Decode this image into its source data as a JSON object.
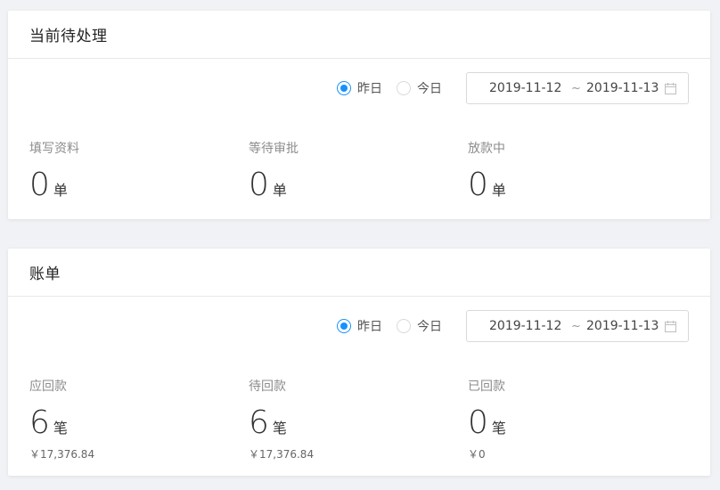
{
  "panel1": {
    "title": "当前待处理",
    "radios": [
      {
        "label": "昨日",
        "checked": true
      },
      {
        "label": "今日",
        "checked": false
      }
    ],
    "range": {
      "start": "2019-11-12",
      "separator": "~",
      "end": "2019-11-13"
    },
    "stats": [
      {
        "label": "填写资料",
        "value": "0",
        "unit": "单"
      },
      {
        "label": "等待审批",
        "value": "0",
        "unit": "单"
      },
      {
        "label": "放款中",
        "value": "0",
        "unit": "单"
      }
    ]
  },
  "panel2": {
    "title": "账单",
    "radios": [
      {
        "label": "昨日",
        "checked": true
      },
      {
        "label": "今日",
        "checked": false
      }
    ],
    "range": {
      "start": "2019-11-12",
      "separator": "~",
      "end": "2019-11-13"
    },
    "stats": [
      {
        "label": "应回款",
        "value": "6",
        "unit": "笔",
        "amount": "￥17,376.84"
      },
      {
        "label": "待回款",
        "value": "6",
        "unit": "笔",
        "amount": "￥17,376.84"
      },
      {
        "label": "已回款",
        "value": "0",
        "unit": "笔",
        "amount": "￥0"
      }
    ]
  },
  "colors": {
    "accent": "#1890ff",
    "background": "#f0f2f5"
  }
}
